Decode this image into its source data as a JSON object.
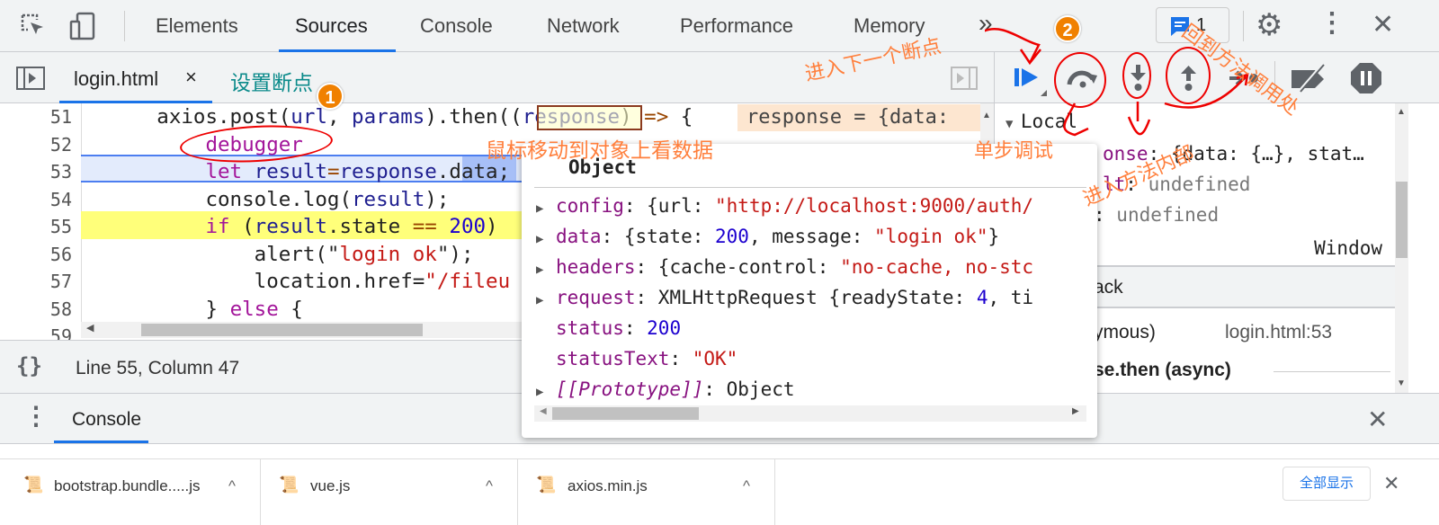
{
  "toolbar": {
    "tabs": [
      "Elements",
      "Sources",
      "Console",
      "Network",
      "Performance",
      "Memory"
    ],
    "active_tab": "Sources",
    "more": "»",
    "issues_count": "1"
  },
  "editor": {
    "file_tab": "login.html",
    "close": "×",
    "lines": [
      {
        "n": "51",
        "tokens": [
          [
            "      axios.post(",
            "df"
          ],
          [
            "url",
            "vr"
          ],
          [
            ", ",
            "df"
          ],
          [
            "params",
            "vr"
          ],
          [
            ").then((",
            "df"
          ],
          [
            "response",
            "vr"
          ],
          [
            ") ",
            "df"
          ],
          [
            "=>",
            "op"
          ],
          [
            " {",
            "df"
          ]
        ]
      },
      {
        "n": "52",
        "tokens": [
          [
            "          ",
            "df"
          ],
          [
            "debugger",
            "kw"
          ]
        ]
      },
      {
        "n": "53",
        "tokens": [
          [
            "          ",
            "df"
          ],
          [
            "let",
            "kw"
          ],
          [
            " ",
            "df"
          ],
          [
            "result",
            "vr"
          ],
          [
            "=",
            "op"
          ],
          [
            "response",
            "vr"
          ],
          [
            ".",
            "df"
          ],
          [
            "data",
            "df"
          ],
          [
            ";",
            "df"
          ]
        ]
      },
      {
        "n": "54",
        "tokens": [
          [
            "          console.log(",
            "df"
          ],
          [
            "result",
            "vr"
          ],
          [
            ");",
            "df"
          ]
        ]
      },
      {
        "n": "55",
        "tokens": [
          [
            "          ",
            "df"
          ],
          [
            "if",
            "kw"
          ],
          [
            " (",
            "df"
          ],
          [
            "result",
            "vr"
          ],
          [
            ".state ",
            "df"
          ],
          [
            "==",
            "op"
          ],
          [
            " ",
            "df"
          ],
          [
            "200",
            "nu"
          ],
          [
            ")",
            "df"
          ]
        ]
      },
      {
        "n": "56",
        "tokens": [
          [
            "              alert(\"",
            "df"
          ],
          [
            "login ok",
            "st"
          ],
          [
            "\");",
            "df"
          ]
        ]
      },
      {
        "n": "57",
        "tokens": [
          [
            "              location.href=",
            "df"
          ],
          [
            "\"/fileu",
            "st"
          ]
        ]
      },
      {
        "n": "58",
        "tokens": [
          [
            "          } ",
            "df"
          ],
          [
            "else",
            "kw"
          ],
          [
            " {",
            "df"
          ]
        ]
      },
      {
        "n": "59",
        "tokens": []
      }
    ],
    "inline_value": "response = {data:"
  },
  "status": {
    "format_icon": "{}",
    "position": "Line 55, Column 47"
  },
  "popup": {
    "title": "Object",
    "rows": [
      {
        "expand": true,
        "tokens": [
          [
            "config",
            "pr"
          ],
          [
            ": {url: ",
            "df"
          ],
          [
            "\"http://localhost:9000/auth/",
            "st"
          ]
        ]
      },
      {
        "expand": true,
        "tokens": [
          [
            "data",
            "pr"
          ],
          [
            ": {state: ",
            "df"
          ],
          [
            "200",
            "nu"
          ],
          [
            ", message: ",
            "df"
          ],
          [
            "\"login ok\"",
            "st"
          ],
          [
            "}",
            "df"
          ]
        ]
      },
      {
        "expand": true,
        "tokens": [
          [
            "headers",
            "pr"
          ],
          [
            ": {cache-control: ",
            "df"
          ],
          [
            "\"no-cache, no-stc",
            "st"
          ]
        ]
      },
      {
        "expand": true,
        "tokens": [
          [
            "request",
            "pr"
          ],
          [
            ": XMLHttpRequest {readyState: ",
            "df"
          ],
          [
            "4",
            "nu"
          ],
          [
            ", ti",
            "df"
          ]
        ]
      },
      {
        "expand": false,
        "tokens": [
          [
            "status",
            "pr"
          ],
          [
            ": ",
            "df"
          ],
          [
            "200",
            "nu"
          ]
        ]
      },
      {
        "expand": false,
        "tokens": [
          [
            "statusText",
            "pr"
          ],
          [
            ": ",
            "df"
          ],
          [
            "\"OK\"",
            "st"
          ]
        ]
      },
      {
        "expand": true,
        "tokens": [
          [
            "[[Prototype]]",
            "it"
          ],
          [
            ": Object",
            "df"
          ]
        ]
      }
    ]
  },
  "scope": {
    "local": "Local",
    "response": "{data: {…}, stat…",
    "result_value": "undefined",
    "third_value": "undefined",
    "global_value": "Window",
    "callstack_fragment": "ack",
    "frame_fragment": "ymous)",
    "frame_location": "login.html:53",
    "async_fragment": "se.then (async)"
  },
  "drawer": {
    "tab": "Console"
  },
  "downloads": {
    "items": [
      "bootstrap.bundle.....js",
      "vue.js",
      "axios.min.js"
    ],
    "show_all": "全部显示"
  },
  "annotations": {
    "set_breakpoint": "设置断点",
    "hover_hint": "鼠标移动到对象上看数据",
    "next_breakpoint": "进入下一个断点",
    "step_over": "单步调试",
    "step_into": "进入方法内部",
    "step_out": "回到方法调用处",
    "badge1": "1",
    "badge2": "2"
  },
  "colors": {
    "accent": "#1a73e8",
    "annotation": "#ff7f3c",
    "pause_line": "#ffff7a",
    "current_line": "#e3ebfc"
  }
}
